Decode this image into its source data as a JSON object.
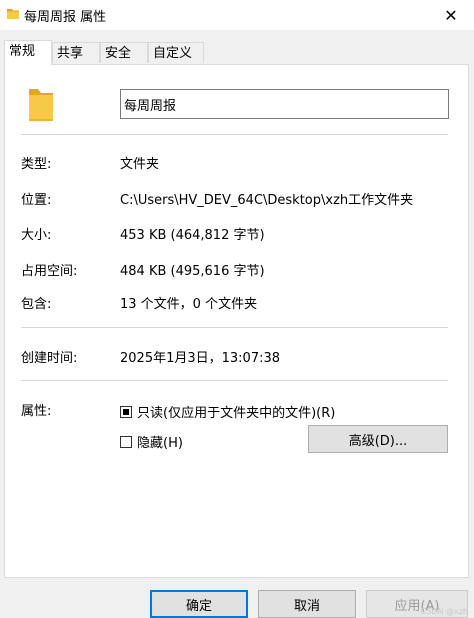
{
  "window": {
    "title": "每周周报 属性",
    "close_glyph": "✕"
  },
  "tabs": [
    {
      "label": "常规",
      "active": true
    },
    {
      "label": "共享",
      "active": false
    },
    {
      "label": "安全",
      "active": false
    },
    {
      "label": "自定义",
      "active": false
    }
  ],
  "general": {
    "name_value": "每周周报",
    "type_label": "类型:",
    "type_value": "文件夹",
    "location_label": "位置:",
    "location_value": "C:\\Users\\HV_DEV_64C\\Desktop\\xzh工作文件夹",
    "size_label": "大小:",
    "size_value": "453 KB (464,812 字节)",
    "disk_size_label": "占用空间:",
    "disk_size_value": "484 KB (495,616 字节)",
    "contains_label": "包含:",
    "contains_value": "13 个文件，0 个文件夹",
    "created_label": "创建时间:",
    "created_value": "2025年1月3日，13:07:38",
    "attributes_label": "属性:",
    "readonly_label": "只读(仅应用于文件夹中的文件)(R)",
    "hidden_label": "隐藏(H)",
    "advanced_label": "高级(D)..."
  },
  "buttons": {
    "ok": "确定",
    "cancel": "取消",
    "apply": "应用(A)"
  },
  "watermark": "CSDN @xzh",
  "colors": {
    "folder": "#f7c948",
    "folder_dark": "#e0a820",
    "accent": "#0078d7"
  }
}
